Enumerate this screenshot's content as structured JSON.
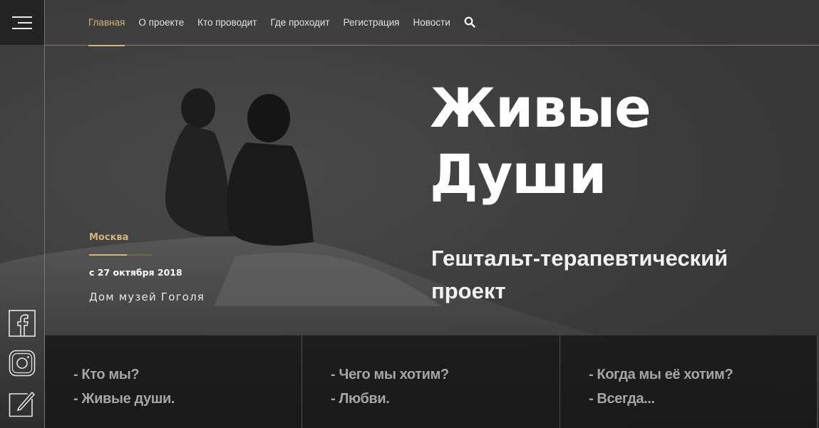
{
  "nav": {
    "items": [
      {
        "label": "Главная",
        "active": true
      },
      {
        "label": "О проекте",
        "active": false
      },
      {
        "label": "Кто проводит",
        "active": false
      },
      {
        "label": "Где проходит",
        "active": false
      },
      {
        "label": "Регистрация",
        "active": false
      },
      {
        "label": "Новости",
        "active": false
      }
    ],
    "search_icon": "search-icon",
    "menu_icon": "hamburger-menu-icon"
  },
  "hero": {
    "title_line1": "Живые",
    "title_line2": "Души",
    "subtitle_line1": "Гештальт-терапевтический",
    "subtitle_line2": "проект"
  },
  "event": {
    "city": "Москва",
    "date": "с 27 октября 2018",
    "venue": "Дом музей Гоголя"
  },
  "band": {
    "columns": [
      {
        "q": "- Кто мы?",
        "a": "- Живые души."
      },
      {
        "q": "- Чего мы хотим?",
        "a": "- Любви."
      },
      {
        "q": "- Когда мы её хотим?",
        "a": "- Всегда..."
      }
    ]
  },
  "social": [
    "facebook-icon",
    "instagram-icon",
    "edit-icon"
  ],
  "colors": {
    "accent": "#d4b67c",
    "background": "#3f3f3f",
    "text": "#ffffff"
  }
}
